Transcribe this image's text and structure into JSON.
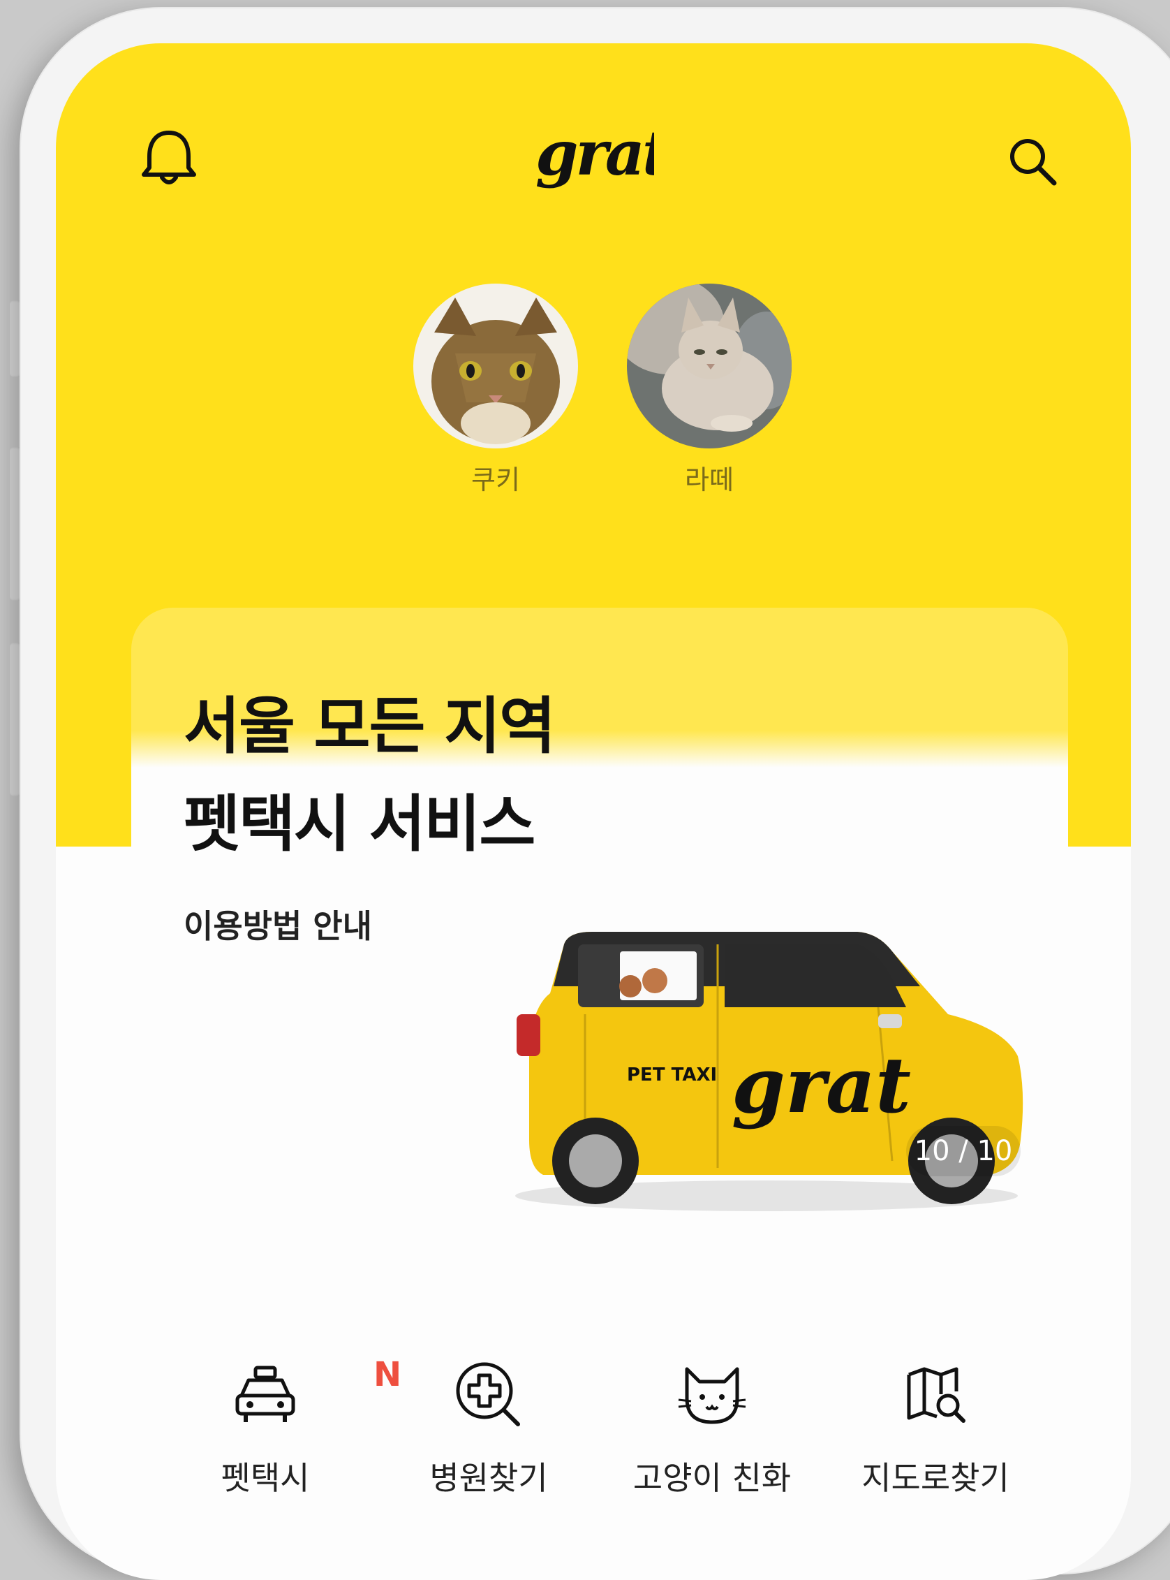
{
  "header": {
    "logo_text": "grat",
    "left_icon": "bell-icon",
    "right_icon": "search-icon"
  },
  "pets": [
    {
      "name": "쿠키"
    },
    {
      "name": "라떼"
    }
  ],
  "banner": {
    "title_line1": "서울 모든 지역",
    "title_line2": "펫택시 서비스",
    "subtitle": "이용방법 안내",
    "car_text": "PET TAXI",
    "car_logo": "grat",
    "page_indicator": "10 / 10"
  },
  "menu": [
    {
      "label": "펫택시",
      "icon": "taxi-icon",
      "badge": "N"
    },
    {
      "label": "병원찾기",
      "icon": "hospital-search-icon"
    },
    {
      "label": "고양이 친화",
      "icon": "cat-icon"
    },
    {
      "label": "지도로찾기",
      "icon": "map-search-icon"
    }
  ],
  "colors": {
    "brand_yellow": "#ffe01b",
    "badge_red": "#ee4f3f"
  }
}
